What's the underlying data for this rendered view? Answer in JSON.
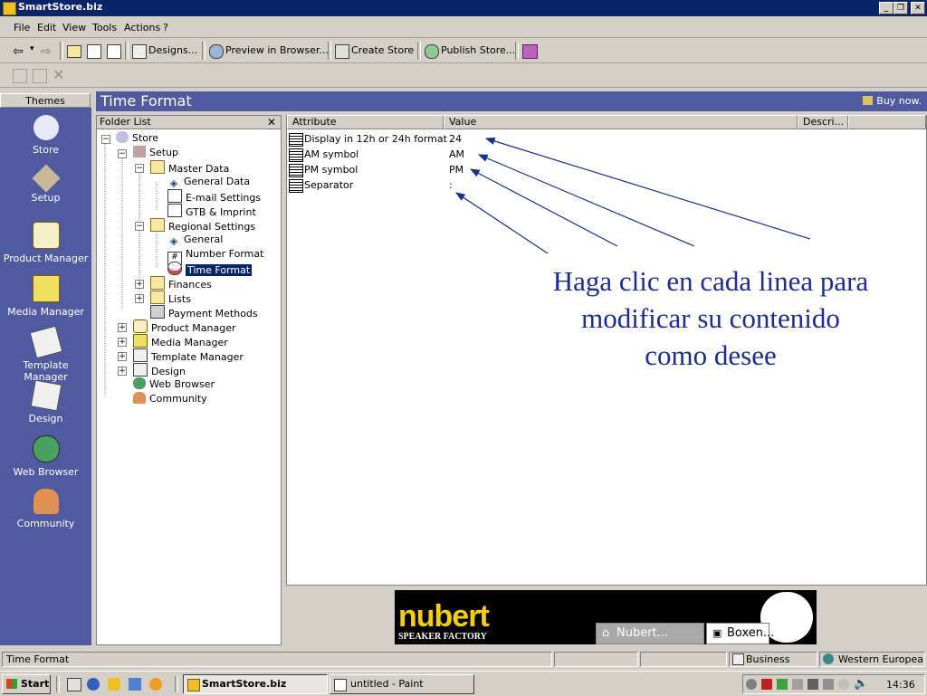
{
  "window": {
    "title": "SmartStore.biz"
  },
  "menu": [
    "File",
    "Edit",
    "View",
    "Tools",
    "Actions",
    "?"
  ],
  "toolbar": {
    "designs": "Designs...",
    "preview": "Preview in Browser...",
    "create_store": "Create Store",
    "publish_store": "Publish Store..."
  },
  "themes": {
    "header": "Themes",
    "items": [
      {
        "label": "Store",
        "icon": "store-icon"
      },
      {
        "label": "Setup",
        "icon": "setup-icon"
      },
      {
        "label": "Product Manager",
        "icon": "product-manager-icon"
      },
      {
        "label": "Media Manager",
        "icon": "media-manager-icon"
      },
      {
        "label": "Template Manager",
        "icon": "template-manager-icon"
      },
      {
        "label": "Design",
        "icon": "design-icon"
      },
      {
        "label": "Web Browser",
        "icon": "web-browser-icon"
      },
      {
        "label": "Community",
        "icon": "community-icon"
      }
    ]
  },
  "page": {
    "title": "Time Format",
    "buy_now": "Buy now."
  },
  "folder_list": {
    "header": "Folder List",
    "close": "✕",
    "tree": [
      {
        "label": "Store"
      },
      {
        "label": "Setup"
      },
      {
        "label": "Master Data"
      },
      {
        "label": "General Data"
      },
      {
        "label": "E-mail Settings"
      },
      {
        "label": "GTB & Imprint"
      },
      {
        "label": "Regional Settings"
      },
      {
        "label": "General"
      },
      {
        "label": "Number Format"
      },
      {
        "label": "Time Format"
      },
      {
        "label": "Finances"
      },
      {
        "label": "Lists"
      },
      {
        "label": "Payment Methods"
      },
      {
        "label": "Product Manager"
      },
      {
        "label": "Media Manager"
      },
      {
        "label": "Template Manager"
      },
      {
        "label": "Design"
      },
      {
        "label": "Web Browser"
      },
      {
        "label": "Community"
      }
    ]
  },
  "table": {
    "columns": [
      "Attribute",
      "Value",
      "Descri..."
    ],
    "rows": [
      {
        "attribute": "Display in 12h or 24h format",
        "value": "24"
      },
      {
        "attribute": "AM symbol",
        "value": "AM"
      },
      {
        "attribute": "PM symbol",
        "value": "PM"
      },
      {
        "attribute": "Separator",
        "value": ":"
      }
    ]
  },
  "annotation": {
    "line1": "Haga clic en cada linea para",
    "line2": "modificar su contenido",
    "line3": "como desee",
    "color": "#1a2ba0"
  },
  "banner": {
    "logo": "nubert",
    "tagline": "SPEAKER FACTORY",
    "tab1": "Nubert...",
    "tab2": "Boxen..."
  },
  "statusbar": {
    "left": "Time Format",
    "business": "Business",
    "region": "Western European"
  },
  "taskbar": {
    "start": "Start",
    "task1": "SmartStore.biz",
    "task2": "untitled - Paint",
    "clock": "14:36"
  },
  "colors": {
    "titlebar": "#0a246a",
    "theme_panel": "#4f5aa0",
    "selection": "#0a246a"
  }
}
